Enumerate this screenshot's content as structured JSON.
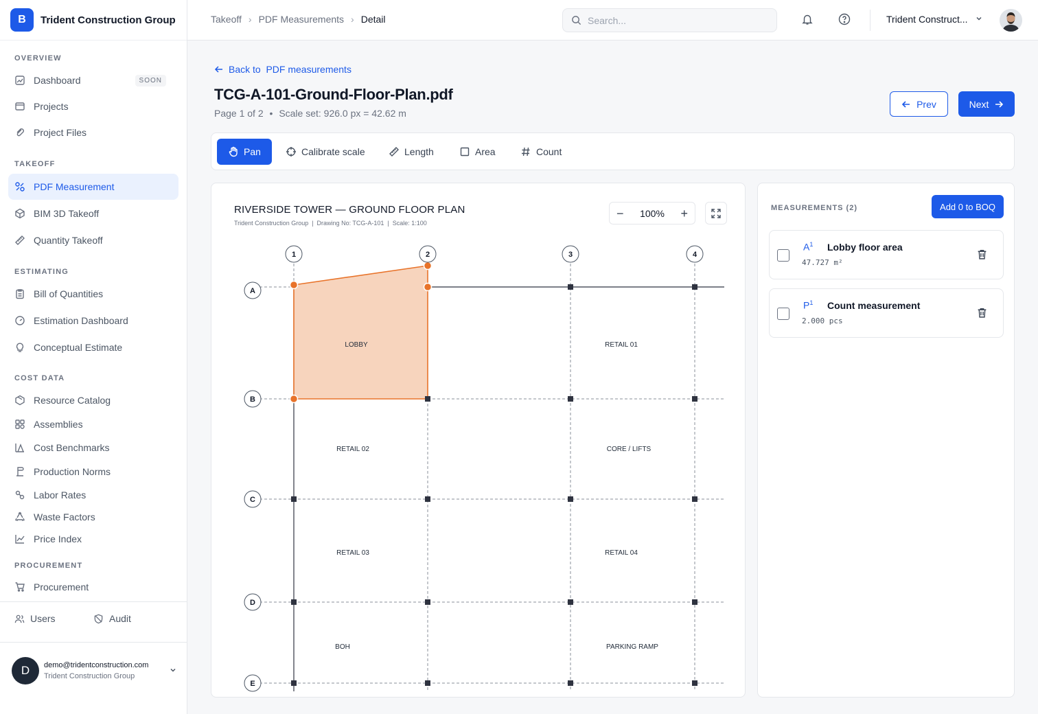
{
  "brand": {
    "logo_letter": "B",
    "name": "Trident Construction Group"
  },
  "sidebar": {
    "sections": {
      "overview": "OVERVIEW",
      "takeoff": "TAKEOFF",
      "estimating": "ESTIMATING",
      "cost_data": "COST DATA",
      "procurement": "PROCUREMENT"
    },
    "items": [
      {
        "label": "Dashboard",
        "icon": "chart-icon",
        "badge": "SOON"
      },
      {
        "label": "Projects",
        "icon": "folder-icon"
      },
      {
        "label": "Project Files",
        "icon": "paperclip-icon"
      },
      {
        "label": "PDF Measurement",
        "icon": "ruler-grid-icon",
        "active": true
      },
      {
        "label": "BIM 3D Takeoff",
        "icon": "cube-icon"
      },
      {
        "label": "Quantity Takeoff",
        "icon": "ruler-icon"
      },
      {
        "label": "Bill of Quantities",
        "icon": "clipboard-icon"
      },
      {
        "label": "Estimation Dashboard",
        "icon": "gauge-icon"
      },
      {
        "label": "Conceptual Estimate",
        "icon": "lightbulb-icon"
      },
      {
        "label": "Resource Catalog",
        "icon": "box-icon"
      },
      {
        "label": "Assemblies",
        "icon": "layers-icon"
      },
      {
        "label": "Cost Benchmarks",
        "icon": "benchmark-icon"
      },
      {
        "label": "Production Norms",
        "icon": "norms-icon"
      },
      {
        "label": "Labor Rates",
        "icon": "labor-icon"
      },
      {
        "label": "Waste Factors",
        "icon": "recycle-icon"
      },
      {
        "label": "Price Index",
        "icon": "trend-icon"
      },
      {
        "label": "Procurement",
        "icon": "cart-icon"
      }
    ],
    "bottom": {
      "users": "Users",
      "audit": "Audit"
    },
    "user": {
      "initial": "D",
      "email": "demo@tridentconstruction.com",
      "org": "Trident Construction Group"
    }
  },
  "header": {
    "breadcrumbs": [
      "Takeoff",
      "PDF Measurements",
      "Detail"
    ],
    "search_placeholder": "Search...",
    "org_switcher": "Trident Construct..."
  },
  "page": {
    "back_label": "Back to  PDF measurements",
    "title": "TCG-A-101-Ground-Floor-Plan.pdf",
    "meta_page": "Page 1 of 2",
    "meta_scale": "Scale set: 926.0 px = 42.62 m",
    "prev_label": "Prev",
    "next_label": "Next"
  },
  "toolbar": {
    "tools": [
      {
        "label": "Pan",
        "icon": "hand-icon",
        "active": true
      },
      {
        "label": "Calibrate scale",
        "icon": "crosshair-icon"
      },
      {
        "label": "Length",
        "icon": "ruler-icon"
      },
      {
        "label": "Area",
        "icon": "square-icon"
      },
      {
        "label": "Count",
        "icon": "hash-icon"
      }
    ]
  },
  "drawing": {
    "title": "RIVERSIDE TOWER — GROUND FLOOR PLAN",
    "subtitle": "Trident Construction Group  |  Drawing No: TCG-A-101  |  Scale: 1:100",
    "zoom": "100%",
    "grid_columns": [
      "1",
      "2",
      "3",
      "4"
    ],
    "grid_rows": [
      "A",
      "B",
      "C",
      "D",
      "E"
    ],
    "rooms": [
      "LOBBY",
      "RETAIL 01",
      "RETAIL 02",
      "CORE / LIFTS",
      "RETAIL 03",
      "RETAIL 04",
      "BOH",
      "PARKING RAMP"
    ],
    "accent": "#e8732a",
    "area_fill": "#f7d4bd"
  },
  "measurements": {
    "header": "MEASUREMENTS (2)",
    "add_button": "Add 0 to BOQ",
    "items": [
      {
        "code": "A",
        "sup": "1",
        "name": "Lobby floor area",
        "value": "47.727 m²"
      },
      {
        "code": "P",
        "sup": "1",
        "name": "Count measurement",
        "value": "2.000 pcs"
      }
    ]
  },
  "colors": {
    "primary": "#1d5ae8",
    "active_bg": "#eaf1fe"
  }
}
